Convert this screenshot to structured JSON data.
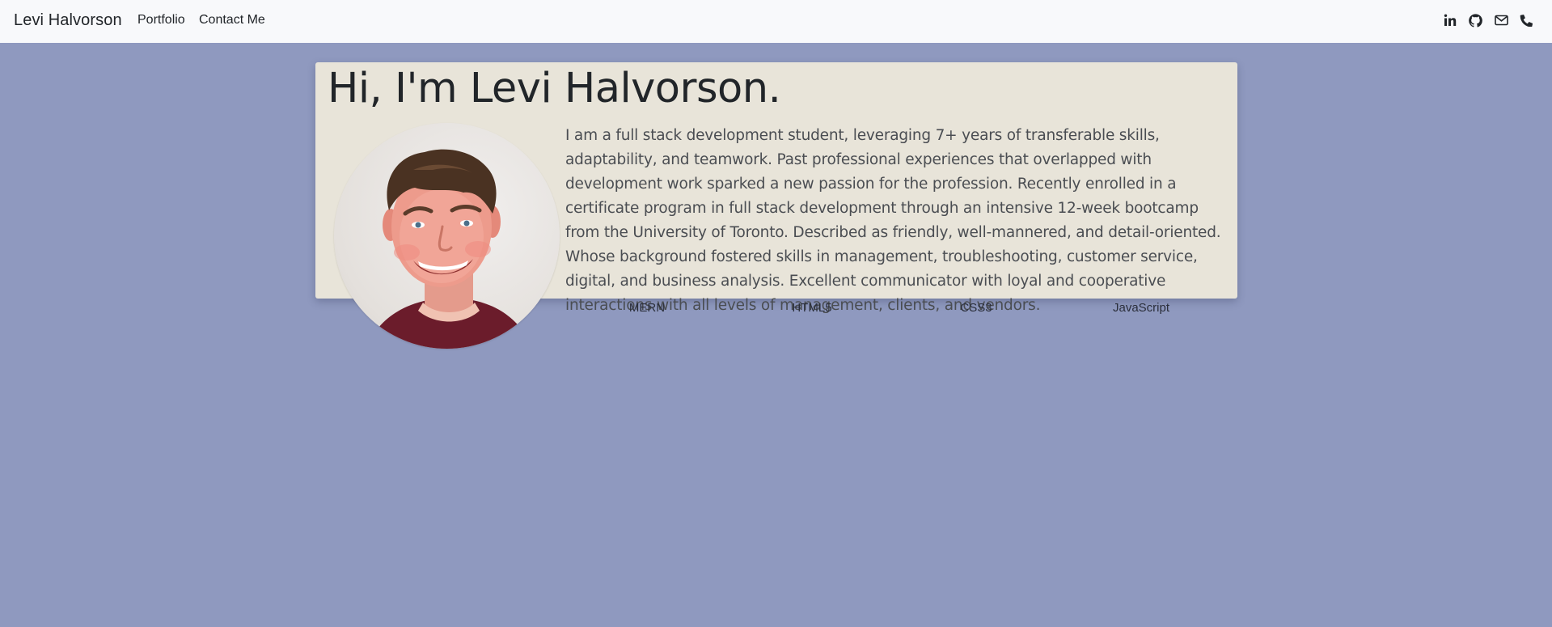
{
  "navbar": {
    "brand": "Levi Halvorson",
    "links": [
      "Portfolio",
      "Contact Me"
    ],
    "social_icons": [
      "linkedin-icon",
      "github-icon",
      "mail-icon",
      "phone-icon"
    ]
  },
  "hero": {
    "title": "Hi, I'm Levi Halvorson.",
    "bio": "I am a full stack development student, leveraging 7+ years of transferable skills, adaptability, and teamwork. Past professional experiences that overlapped with development work sparked a new passion for the profession. Recently enrolled in a certificate program in full stack development through an intensive 12-week bootcamp from the University of Toronto. Described as friendly, well-mannered, and detail-oriented. Whose background fostered skills in management, troubleshooting, customer service, digital, and business analysis. Excellent communicator with loyal and cooperative interactions with all levels of management, clients, and vendors."
  },
  "skills": [
    "MERN",
    "HTML5",
    "CSS3",
    "JavaScript"
  ],
  "colors": {
    "page_background": "#8f99bf",
    "navbar_background": "#f8f9fb",
    "card_background": "#e8e4d9",
    "text": "#212529"
  }
}
